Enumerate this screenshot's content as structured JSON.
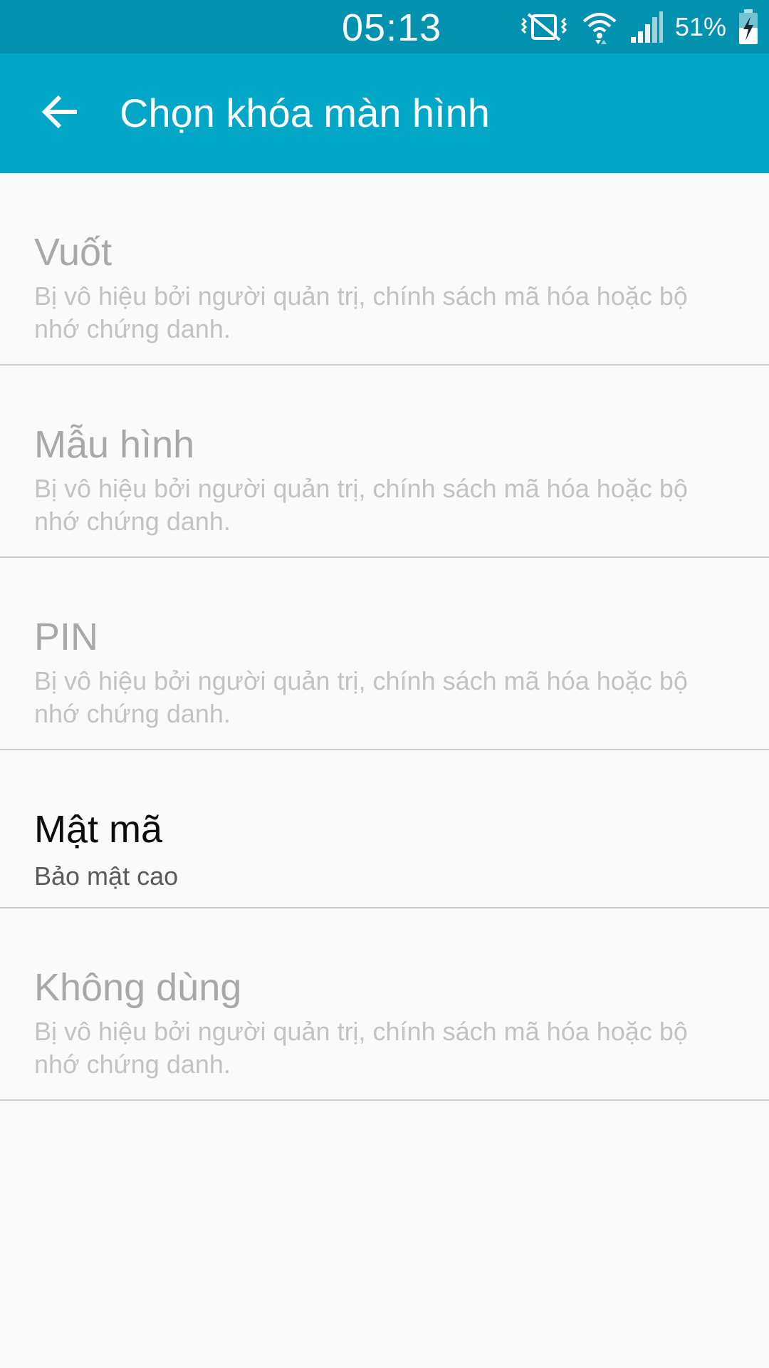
{
  "status_bar": {
    "time": "05:13",
    "battery_percent": "51%",
    "icons": [
      "vibrate-mute-icon",
      "wifi-icon",
      "signal-icon",
      "battery-charging-icon"
    ]
  },
  "app_bar": {
    "back_icon": "arrow-left-icon",
    "title": "Chọn khóa màn hình"
  },
  "options": [
    {
      "title": "Vuốt",
      "subtitle": "Bị vô hiệu bởi người quản trị, chính sách mã hóa hoặc bộ nhớ chứng danh.",
      "enabled": false
    },
    {
      "title": "Mẫu hình",
      "subtitle": "Bị vô hiệu bởi người quản trị, chính sách mã hóa hoặc bộ nhớ chứng danh.",
      "enabled": false
    },
    {
      "title": "PIN",
      "subtitle": "Bị vô hiệu bởi người quản trị, chính sách mã hóa hoặc bộ nhớ chứng danh.",
      "enabled": false
    },
    {
      "title": "Mật mã",
      "subtitle": "Bảo mật cao",
      "enabled": true
    },
    {
      "title": "Không dùng",
      "subtitle": "Bị vô hiệu bởi người quản trị, chính sách mã hóa hoặc bộ nhớ chứng danh.",
      "enabled": false
    }
  ],
  "colors": {
    "status_bar": "#0292b0",
    "app_bar": "#02a6c6",
    "background": "#fafafa",
    "disabled_text": "#a8a8a8",
    "enabled_text": "#0c0c0c"
  }
}
